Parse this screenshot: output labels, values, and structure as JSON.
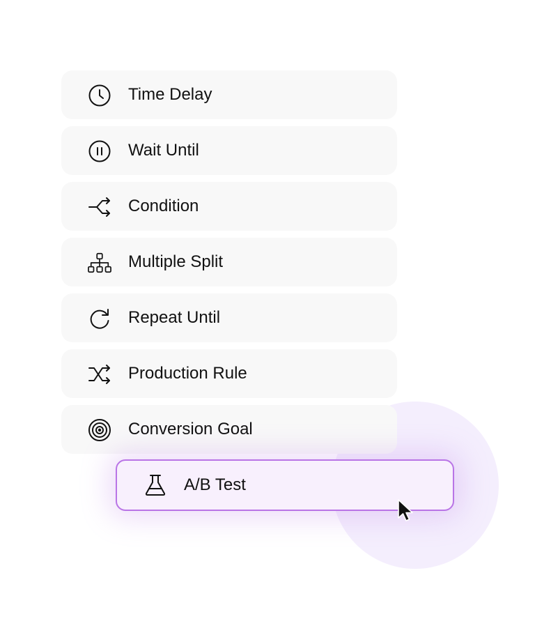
{
  "menu": {
    "items": [
      {
        "label": "Time Delay",
        "icon": "clock-icon"
      },
      {
        "label": "Wait Until",
        "icon": "pause-circle-icon"
      },
      {
        "label": "Condition",
        "icon": "branch-icon"
      },
      {
        "label": "Multiple Split",
        "icon": "hierarchy-icon"
      },
      {
        "label": "Repeat Until",
        "icon": "refresh-icon"
      },
      {
        "label": "Production Rule",
        "icon": "shuffle-icon"
      },
      {
        "label": "Conversion Goal",
        "icon": "target-icon"
      }
    ],
    "dragging_item": {
      "label": "A/B Test",
      "icon": "flask-icon"
    }
  },
  "colors": {
    "item_bg": "#f8f8f8",
    "drag_bg": "#f8f0fd",
    "drag_border": "#b974e6",
    "glow": "#f4eefd",
    "text": "#111111"
  }
}
